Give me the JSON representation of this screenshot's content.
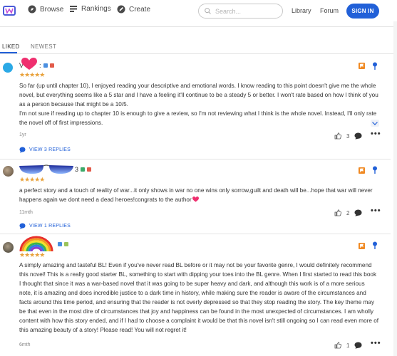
{
  "nav": {
    "items": [
      {
        "label": "Browse",
        "icon": "compass-icon"
      },
      {
        "label": "Rankings",
        "icon": "rankings-icon"
      },
      {
        "label": "Create",
        "icon": "create-icon"
      }
    ],
    "search_placeholder": "Search...",
    "library": "Library",
    "forum": "Forum",
    "signin": "SIGN IN"
  },
  "tabs": [
    {
      "label": "LIKED",
      "active": true
    },
    {
      "label": "NEWEST",
      "active": false
    }
  ],
  "colors": {
    "accent": "#2160d8",
    "star": "#e9a23b",
    "flag": "#f08a24"
  },
  "reviews": [
    {
      "username": "V",
      "user_suffix": ":",
      "rating": "★★★★★",
      "paragraphs": [
        "So far (up until chapter 10), I enjoyed reading your descriptive and emotional words. I know reading to this point doesn't give me the whole novel, but everything seems like a 5 star and I have a feeling it'll continue to be a steady 5 or better. I won't rate based on how I think of you as a person because that might be a 10/5.",
        "I'm not sure if reading up to chapter 10 is enough to give a review, so I'm not reviewing what I think is the whole novel. Instead, I'll only rate the novel off of first impressions."
      ],
      "time": "1yr",
      "replies": "VIEW 3 REPLIES",
      "likes": "3"
    },
    {
      "username": "",
      "user_suffix": "3",
      "rating": "★★★★★",
      "paragraphs": [
        "a perfect story and a touch of reality of war...it only shows in war no one wins only sorrow,guilt and death will be...hope that war will never happens again we dont need a dead heroes!congrats to the author"
      ],
      "time": "11mth",
      "replies": "VIEW 1 REPLIES",
      "likes": "2"
    },
    {
      "username": "",
      "user_suffix": "",
      "rating": "★★★★★",
      "paragraphs": [
        "A simply amazing and tasteful BL! Even if you've never read BL before or it may not be your favorite genre, I would definitely recommend this novel! This is a really good starter BL, something to start with dipping your toes into the BL genre. When I first started to read this book I thought that since it was a war-based novel that it was going to be super heavy and dark, and although this work is of a more serious note, it is amazing and does incredible justice to a dark time in history, while making sure the reader is aware of the circumstances and facts around this time period, and ensuring that the reader is not overly depressed so that they stop reading the story. The key theme may be that even in the most dire of circumstances that joy and happiness can be found in the most unexpected of circumstances. I am wholly content with how this story ended, and if I had to choose a complaint it would be that this novel isn't still ongoing so I can read even more of this amazing beauty of a story! Please read! You will not regret it!"
      ],
      "time": "6mth",
      "replies": "",
      "likes": "1"
    }
  ]
}
